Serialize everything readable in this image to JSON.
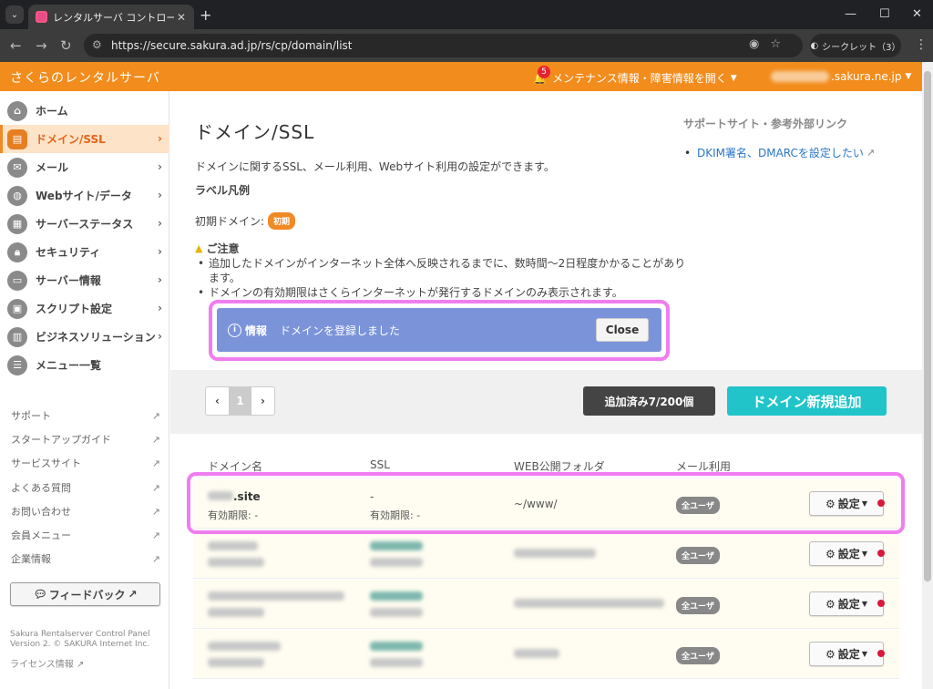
{
  "browser": {
    "tab_title": "レンタルサーバ コントロールパネル",
    "url": "https://secure.sakura.ad.jp/rs/cp/domain/list",
    "incognito_label": "シークレット（3）"
  },
  "header": {
    "brand": "さくらのレンタルサーバ",
    "notification_count": "5",
    "maintenance_label": "メンテナンス情報・障害情報を開く",
    "account_suffix": ".sakura.ne.jp"
  },
  "sidebar": {
    "items": [
      {
        "label": "ホーム",
        "icon": "home-icon"
      },
      {
        "label": "ドメイン/SSL",
        "icon": "domain-icon",
        "active": true
      },
      {
        "label": "メール",
        "icon": "mail-icon"
      },
      {
        "label": "Webサイト/データ",
        "icon": "globe-icon"
      },
      {
        "label": "サーバーステータス",
        "icon": "chart-icon"
      },
      {
        "label": "セキュリティ",
        "icon": "lock-icon"
      },
      {
        "label": "サーバー情報",
        "icon": "server-icon"
      },
      {
        "label": "スクリプト設定",
        "icon": "script-icon"
      },
      {
        "label": "ビジネスソリューション",
        "icon": "business-icon"
      },
      {
        "label": "メニュー一覧",
        "icon": "list-icon"
      }
    ],
    "links": [
      "サポート",
      "スタートアップガイド",
      "サービスサイト",
      "よくある質問",
      "お問い合わせ",
      "会員メニュー",
      "企業情報"
    ],
    "feedback": "フィードバック",
    "footer_line1": "Sakura Rentalserver Control Panel",
    "footer_line2": "Version 2. © SAKURA Internet Inc.",
    "license": "ライセンス情報"
  },
  "main": {
    "title": "ドメイン/SSL",
    "description": "ドメインに関するSSL、メール利用、Webサイト利用の設定ができます。",
    "legend_title": "ラベル凡例",
    "legend_label": "初期ドメイン:",
    "legend_pill": "初期",
    "notice_title": "ご注意",
    "notices": [
      "追加したドメインがインターネット全体へ反映されるまでに、数時間〜2日程度かかることがあります。",
      "ドメインの有効期限はさくらインターネットが発行するドメインのみ表示されます。"
    ],
    "support_title": "サポートサイト・参考外部リンク",
    "support_link": "DKIM署名、DMARCを設定したい",
    "info": {
      "label": "情報",
      "message": "ドメインを登録しました",
      "close": "Close"
    },
    "pager": {
      "prev": "‹",
      "current": "1",
      "next": "›"
    },
    "count_label": "追加済み7/200個",
    "add_button": "ドメイン新規追加",
    "table": {
      "headers": [
        "ドメイン名",
        "SSL",
        "WEB公開フォルダ",
        "メール利用"
      ],
      "first_row": {
        "domain_suffix": ".site",
        "expiry": "有効期限: -",
        "ssl": "-",
        "ssl_expiry": "有効期限: -",
        "folder": "~/www/",
        "mail": "全ユーザ",
        "settings": "設定"
      },
      "other_mail": "全ユーザ",
      "other_settings": "設定"
    }
  }
}
